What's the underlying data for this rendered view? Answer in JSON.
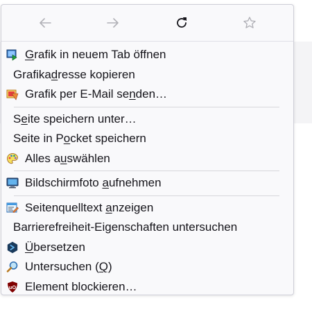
{
  "nav": {
    "back_icon": "arrow-left-icon",
    "forward_icon": "arrow-right-icon",
    "reload_icon": "reload-icon",
    "bookmark_icon": "star-icon"
  },
  "menu": {
    "items": [
      {
        "icon": "open-image-tab-icon",
        "pre": "",
        "key": "G",
        "post": "rafik in neuem Tab öffnen"
      },
      {
        "icon": "",
        "pre": "Grafika",
        "key": "d",
        "post": "resse kopieren"
      },
      {
        "icon": "email-image-icon",
        "pre": "Grafik per E-Mail se",
        "key": "n",
        "post": "den…"
      },
      {
        "icon": "",
        "pre": "S",
        "key": "e",
        "post": "ite speichern unter…"
      },
      {
        "icon": "",
        "pre": "Seite in P",
        "key": "o",
        "post": "cket speichern"
      },
      {
        "icon": "select-all-palette-icon",
        "pre": "Alles a",
        "key": "u",
        "post": "swählen"
      },
      {
        "icon": "screenshot-monitor-icon",
        "pre": "Bildschirmfoto ",
        "key": "a",
        "post": "ufnehmen"
      },
      {
        "icon": "view-source-icon",
        "pre": "Seitenquelltext ",
        "key": "a",
        "post": "nzeigen"
      },
      {
        "icon": "",
        "pre": "Barrierefreiheit-Eigenschaften untersuchen",
        "key": "",
        "post": ""
      },
      {
        "icon": "translate-icon",
        "pre": "",
        "key": "Ü",
        "post": "bersetzen"
      },
      {
        "icon": "magnifier-icon",
        "pre": "Untersuchen (",
        "key": "Q",
        "post": ")"
      },
      {
        "icon": "ublock-shield-icon",
        "pre": "Element blockieren…",
        "key": "",
        "post": ""
      }
    ]
  },
  "colors": {
    "menu_bg": "#f9f9fb",
    "text": "#15141a",
    "separator": "#d7d7db",
    "ublock_red": "#800000"
  }
}
